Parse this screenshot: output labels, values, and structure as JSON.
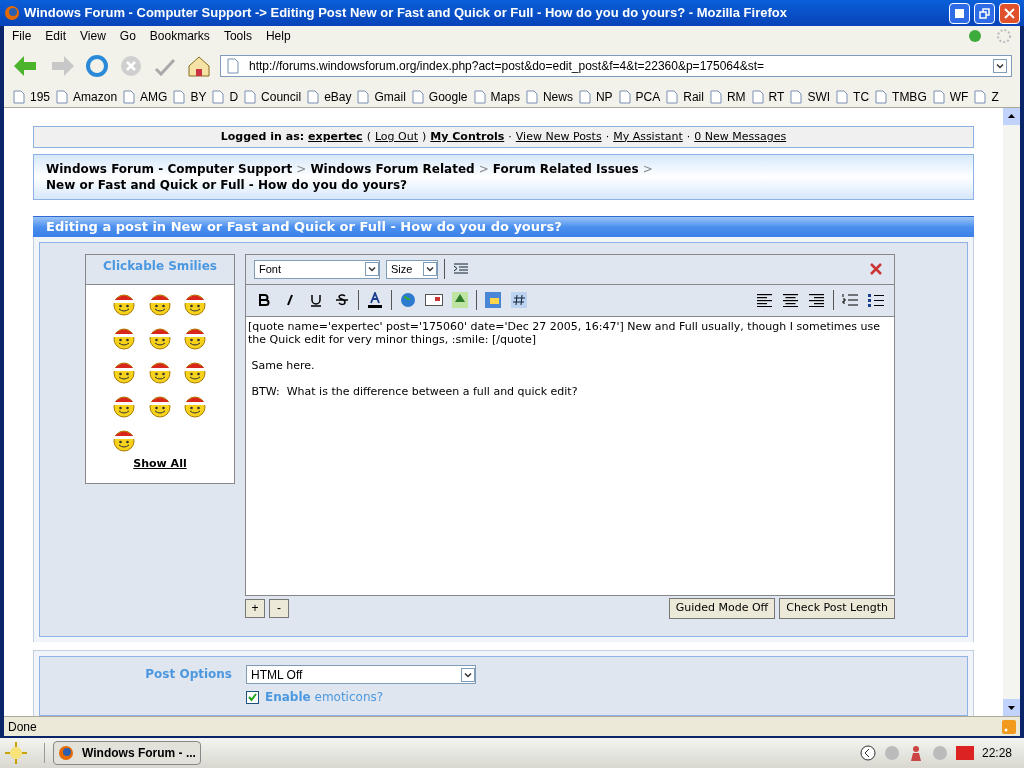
{
  "window": {
    "title": "Windows Forum - Computer Support -> Editing Post New or Fast and Quick or Full - How do you do yours? - Mozilla Firefox"
  },
  "menu": [
    "File",
    "Edit",
    "View",
    "Go",
    "Bookmarks",
    "Tools",
    "Help"
  ],
  "address": {
    "url": "http://forums.windowsforum.org/index.php?act=post&do=edit_post&f=4&t=22360&p=175064&st="
  },
  "bookmarks": [
    "195",
    "Amazon",
    "AMG",
    "BY",
    "D",
    "Council",
    "eBay",
    "Gmail",
    "Google",
    "Maps",
    "News",
    "NP",
    "PCA",
    "Rail",
    "RM",
    "RT",
    "SWI",
    "TC",
    "TMBG",
    "WF",
    "Z"
  ],
  "user_bar": [
    {
      "kind": "label",
      "text": "Logged in as:"
    },
    {
      "kind": "strong_link",
      "text": "expertec"
    },
    {
      "kind": "punct",
      "text": "("
    },
    {
      "kind": "link",
      "text": "Log Out"
    },
    {
      "kind": "punct",
      "text": ")"
    },
    {
      "kind": "strong_link",
      "text": "My Controls"
    },
    {
      "kind": "punct",
      "text": "·"
    },
    {
      "kind": "link",
      "text": "View New Posts"
    },
    {
      "kind": "punct",
      "text": "·"
    },
    {
      "kind": "link",
      "text": "My Assistant"
    },
    {
      "kind": "punct",
      "text": "·"
    },
    {
      "kind": "link",
      "text": "0 New Messages"
    }
  ],
  "breadcrumb": {
    "separator": ">",
    "items": [
      "Windows Forum - Computer Support",
      "Windows Forum Related",
      "Forum Related Issues",
      "New or Fast and Quick or Full - How do you do yours?"
    ]
  },
  "editor": {
    "title": "Editing a post in New or Fast and Quick or Full - How do you do yours?",
    "smilies": {
      "title": "Clickable Smilies",
      "show_all": "Show All"
    },
    "font": "Font",
    "size": "Size",
    "paragraphs": [
      "[quote name='expertec' post='175060' date='Dec 27 2005, 16:47'] New and Full usually, though I sometimes use the Quick edit for very minor things, :smile: [/quote]",
      " Same here.",
      " BTW:  What is the difference between a full and quick edit?"
    ],
    "buttons_left": [
      "+",
      "-"
    ],
    "buttons_right": [
      "Guided Mode Off",
      "Check Post Length"
    ]
  },
  "post_options": {
    "label": "Post Options",
    "select": "HTML Off",
    "emoticons": {
      "text": "**Enable** emoticons?",
      "checked": true
    }
  },
  "status_bar": "Done",
  "taskbar": {
    "task": "Windows Forum - ...",
    "clock": "22:28"
  }
}
